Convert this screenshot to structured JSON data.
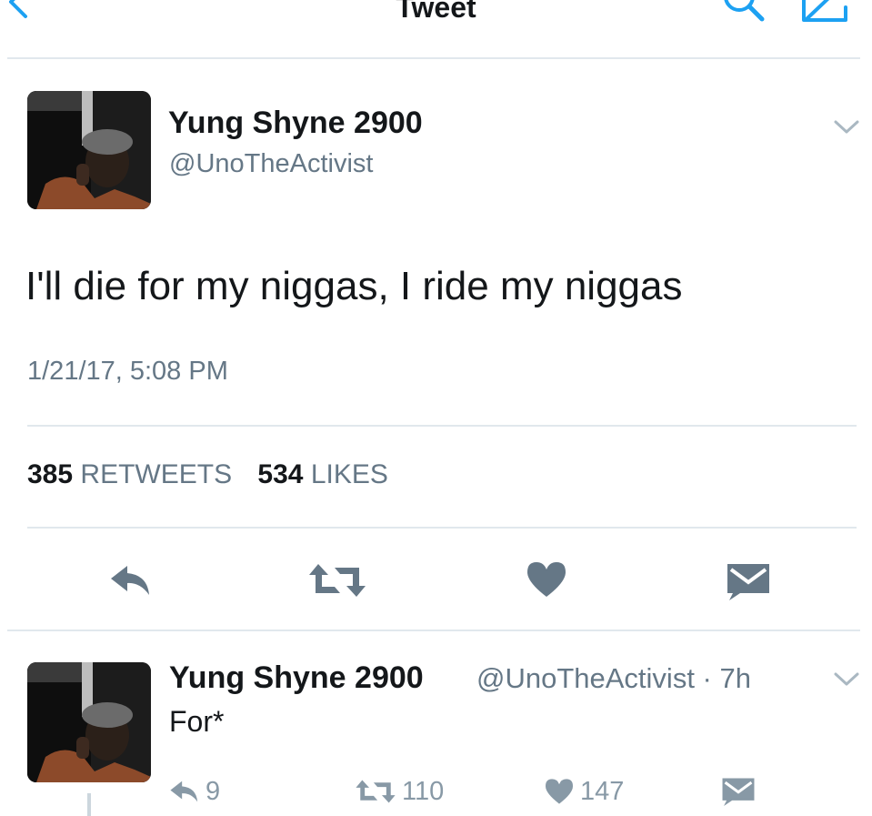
{
  "nav": {
    "title": "Tweet",
    "back_icon": "chevron-left-icon",
    "search_icon": "search-icon",
    "compose_icon": "compose-icon",
    "accent": "#1da1f2"
  },
  "tweet": {
    "name": "Yung Shyne 2900",
    "handle": "@UnoTheActivist",
    "text": "I'll die for my niggas, I ride my niggas",
    "timestamp": "1/21/17, 5:08 PM",
    "retweets_count": "385",
    "retweets_label": "RETWEETS",
    "likes_count": "534",
    "likes_label": "LIKES",
    "actions": [
      "reply-icon",
      "retweet-icon",
      "heart-icon",
      "message-icon"
    ]
  },
  "reply": {
    "name": "Yung Shyne 2900",
    "meta": "@UnoTheActivist · 7h",
    "text": "For*",
    "reply_count": "9",
    "retweet_count": "110",
    "like_count": "147"
  },
  "colors": {
    "text": "#14171a",
    "secondary": "#657786",
    "icon": "#657786",
    "divider": "#e1e8ed"
  }
}
